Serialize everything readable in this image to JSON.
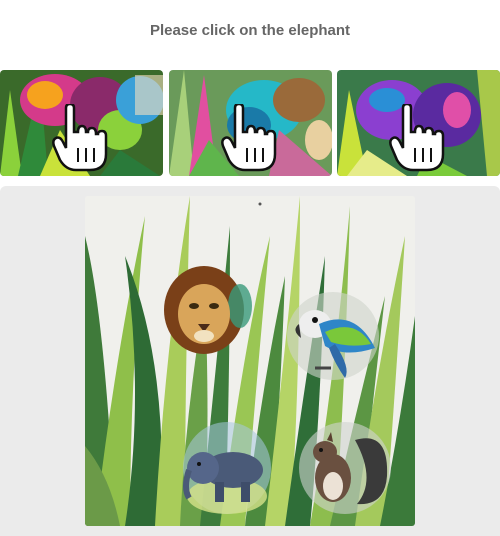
{
  "prompt": {
    "text": "Please click on the elephant"
  },
  "examples": [
    {
      "icon": "hand-pointer-icon",
      "palette": [
        "#d43a8a",
        "#f6a21e",
        "#8bd13b",
        "#3aa0d8"
      ]
    },
    {
      "icon": "hand-pointer-icon",
      "palette": [
        "#25b8c8",
        "#e14fa0",
        "#5fb54c",
        "#9a6a3a"
      ]
    },
    {
      "icon": "hand-pointer-icon",
      "palette": [
        "#8b3fd0",
        "#c9e23a",
        "#2a8fd6",
        "#e04fa8"
      ]
    }
  ],
  "puzzle": {
    "animals": [
      "lion",
      "parrot",
      "elephant",
      "squirrel"
    ],
    "target": "elephant"
  }
}
